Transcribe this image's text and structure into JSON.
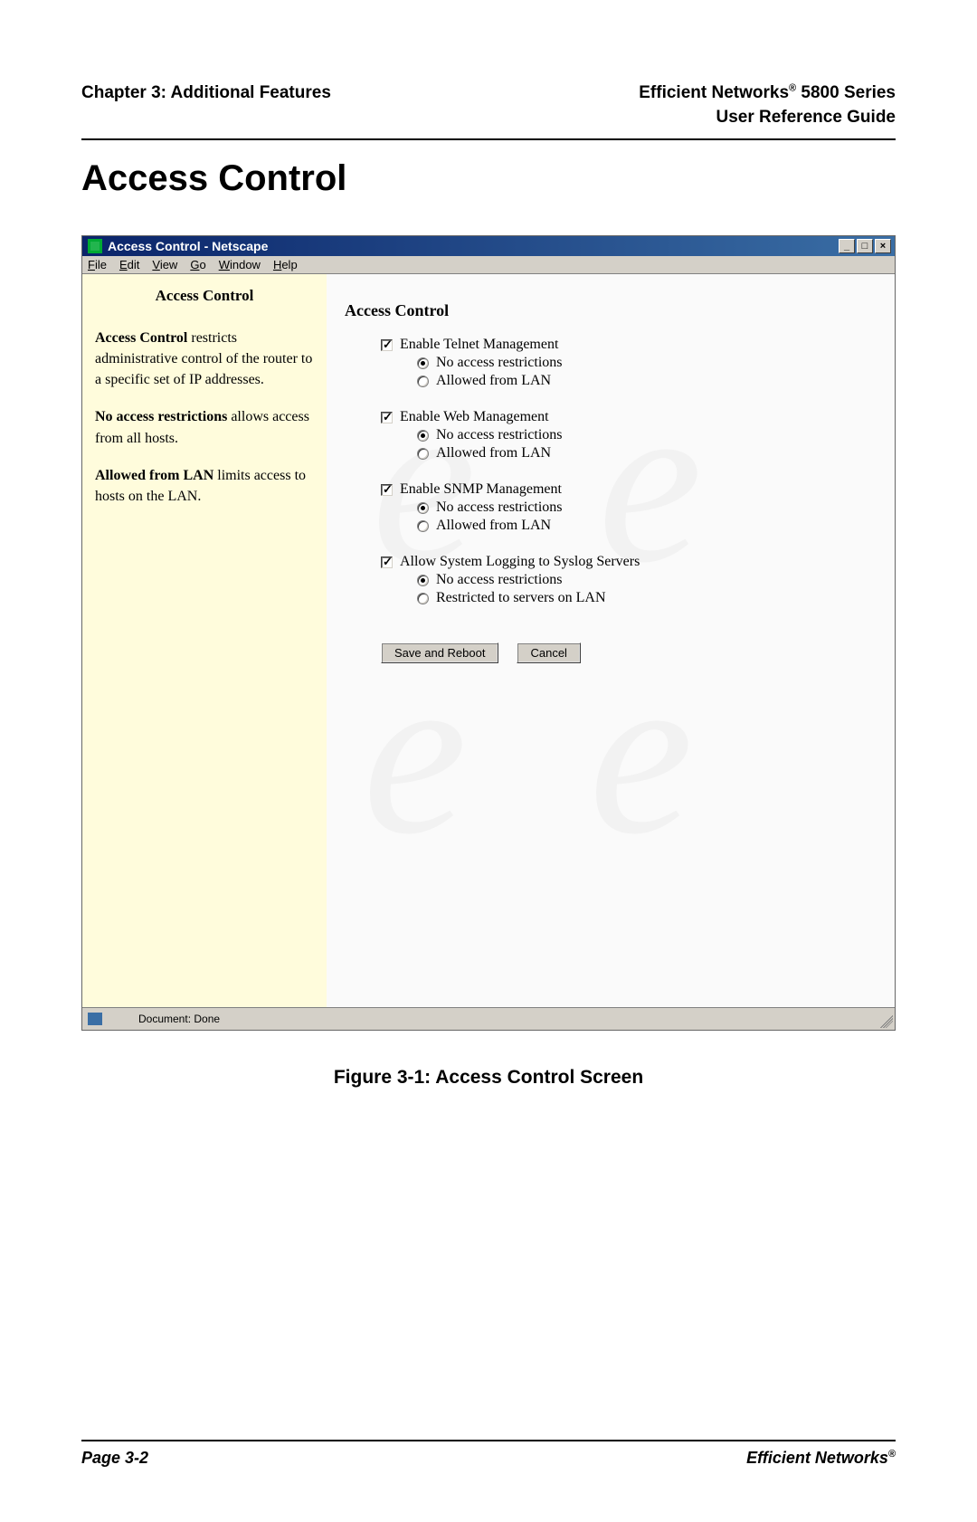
{
  "header": {
    "left": "Chapter 3: Additional Features",
    "right_line1_prefix": "Efficient Networks",
    "right_line1_suffix": " 5800 Series",
    "right_line2": "User Reference Guide",
    "reg": "®"
  },
  "page_title": "Access Control",
  "window": {
    "title": "Access Control - Netscape",
    "min": "_",
    "max": "□",
    "close": "×"
  },
  "menubar": {
    "file": "File",
    "edit": "Edit",
    "view": "View",
    "go": "Go",
    "window": "Window",
    "help": "Help"
  },
  "sidebar": {
    "title": "Access Control",
    "p1_b": "Access Control",
    "p1_rest": " restricts administrative control of the router to a specific set of IP addresses.",
    "p2_b": "No access restrictions",
    "p2_rest": " allows access from all hosts.",
    "p3_b": "Allowed from LAN",
    "p3_rest": " limits access to hosts on the LAN."
  },
  "main": {
    "title": "Access Control",
    "groups": [
      {
        "checkbox": "Enable Telnet Management",
        "radios": [
          "No access restrictions",
          "Allowed from LAN"
        ],
        "selected": 0
      },
      {
        "checkbox": "Enable Web Management",
        "radios": [
          "No access restrictions",
          "Allowed from LAN"
        ],
        "selected": 0
      },
      {
        "checkbox": "Enable SNMP Management",
        "radios": [
          "No access restrictions",
          "Allowed from LAN"
        ],
        "selected": 0
      },
      {
        "checkbox": "Allow System Logging to Syslog Servers",
        "radios": [
          "No access restrictions",
          "Restricted to servers on LAN"
        ],
        "selected": 0
      }
    ],
    "save_btn": "Save and Reboot",
    "cancel_btn": "Cancel"
  },
  "statusbar": {
    "text": "Document: Done"
  },
  "figure_caption": "Figure 3-1:  Access Control Screen",
  "footer": {
    "page": "Page 3-2",
    "brand": "Efficient Networks",
    "reg": "®"
  }
}
